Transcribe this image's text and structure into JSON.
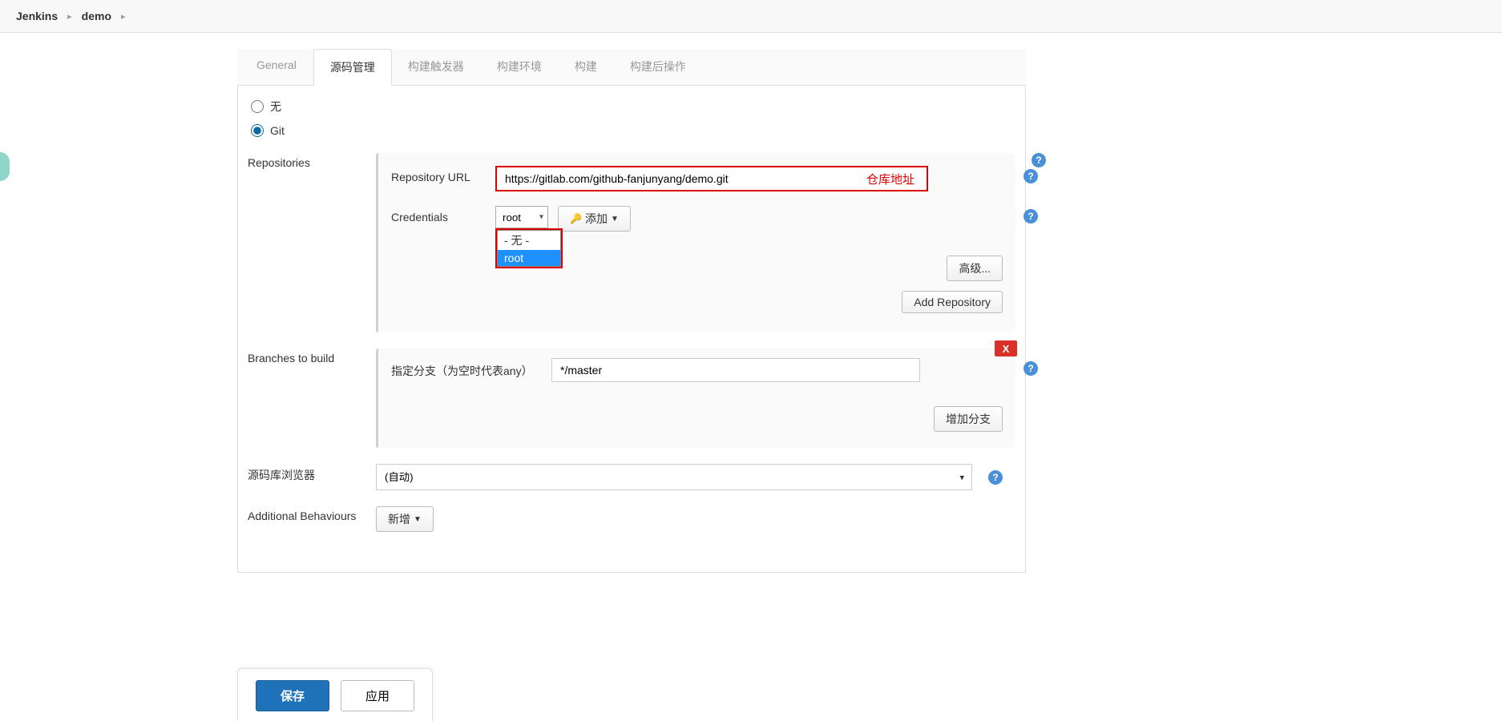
{
  "breadcrumb": {
    "jenkins": "Jenkins",
    "project": "demo"
  },
  "tabs": {
    "general": "General",
    "scm": "源码管理",
    "triggers": "构建触发器",
    "env": "构建环境",
    "build": "构建",
    "post": "构建后操作"
  },
  "scm": {
    "none_label": "无",
    "git_label": "Git",
    "repositories_label": "Repositories",
    "repo_url_label": "Repository URL",
    "repo_url_value": "https://gitlab.com/github-fanjunyang/demo.git",
    "repo_annot": "仓库地址",
    "credentials_label": "Credentials",
    "cred_selected": "root",
    "cred_option_none": "- 无 -",
    "cred_option_root": "root",
    "add_btn": "添加",
    "advanced_btn": "高级...",
    "add_repo_btn": "Add Repository",
    "branches_label": "Branches to build",
    "branch_spec_label": "指定分支（为空时代表any）",
    "branch_value": "*/master",
    "add_branch_btn": "增加分支",
    "browser_label": "源码库浏览器",
    "browser_value": "(自动)",
    "behaviours_label": "Additional Behaviours",
    "add_behaviour_btn": "新增"
  },
  "footer": {
    "save": "保存",
    "apply": "应用"
  },
  "help": "?"
}
